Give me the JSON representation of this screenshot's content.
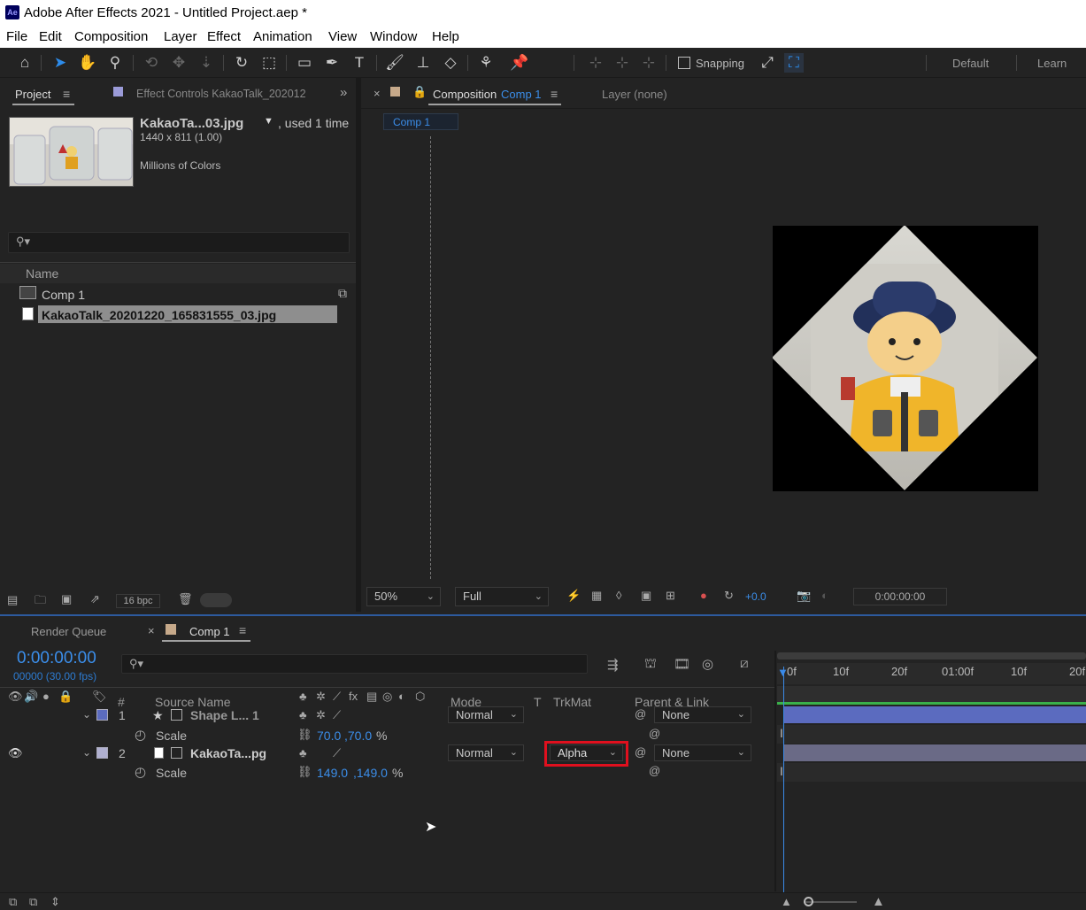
{
  "app": {
    "title": "Adobe After Effects 2021 - Untitled Project.aep *",
    "logo": "Ae"
  },
  "menu": [
    "File",
    "Edit",
    "Composition",
    "Layer",
    "Effect",
    "Animation",
    "View",
    "Window",
    "Help"
  ],
  "toolbar": {
    "snapping_label": "Snapping",
    "workspace_default": "Default",
    "workspace_learn": "Learn"
  },
  "project": {
    "tab_project": "Project",
    "tab_effect_controls": "Effect Controls KakaoTalk_202012",
    "footage_name": "KakaoTa...03.jpg",
    "used": ", used 1 time",
    "dimensions": "1440 x 811 (1.00)",
    "colors": "Millions of Colors",
    "col_name": "Name",
    "items": [
      {
        "name": "Comp 1",
        "icon": "composition-icon"
      },
      {
        "name": "KakaoTalk_20201220_165831555_03.jpg",
        "icon": "image-file-icon"
      }
    ],
    "bpc": "16 bpc"
  },
  "viewer": {
    "tab_comp_label": "Composition",
    "tab_comp_name": "Comp 1",
    "tab_layer": "Layer (none)",
    "crumb": "Comp 1",
    "zoom": "50%",
    "resolution": "Full",
    "exposure": "+0.0",
    "timecode": "0:00:00:00"
  },
  "timeline": {
    "tab_render_queue": "Render Queue",
    "tab_comp": "Comp 1",
    "current_time": "0:00:00:00",
    "frames": "00000 (30.00 fps)",
    "columns": {
      "hash": "#",
      "source_name": "Source Name",
      "mode": "Mode",
      "t": "T",
      "trkmat": "TrkMat",
      "parent": "Parent & Link"
    },
    "layers": [
      {
        "num": "1",
        "name": "Shape L... 1",
        "mode": "Normal",
        "trkmat": "",
        "parent": "None",
        "prop": "Scale",
        "val1": "70.0",
        "val2": ",70.0",
        "unit": "%"
      },
      {
        "num": "2",
        "name": "KakaoTa...pg",
        "mode": "Normal",
        "trkmat": "Alpha",
        "parent": "None",
        "prop": "Scale",
        "val1": "149.0",
        "val2": ",149.0",
        "unit": "%"
      }
    ],
    "ruler": [
      "0f",
      "10f",
      "20f",
      "01:00f",
      "10f",
      "20f"
    ],
    "highlight_color": "#e0101e",
    "layer1_color": "#5b6bbf",
    "layer2_color": "#6a6a86"
  }
}
